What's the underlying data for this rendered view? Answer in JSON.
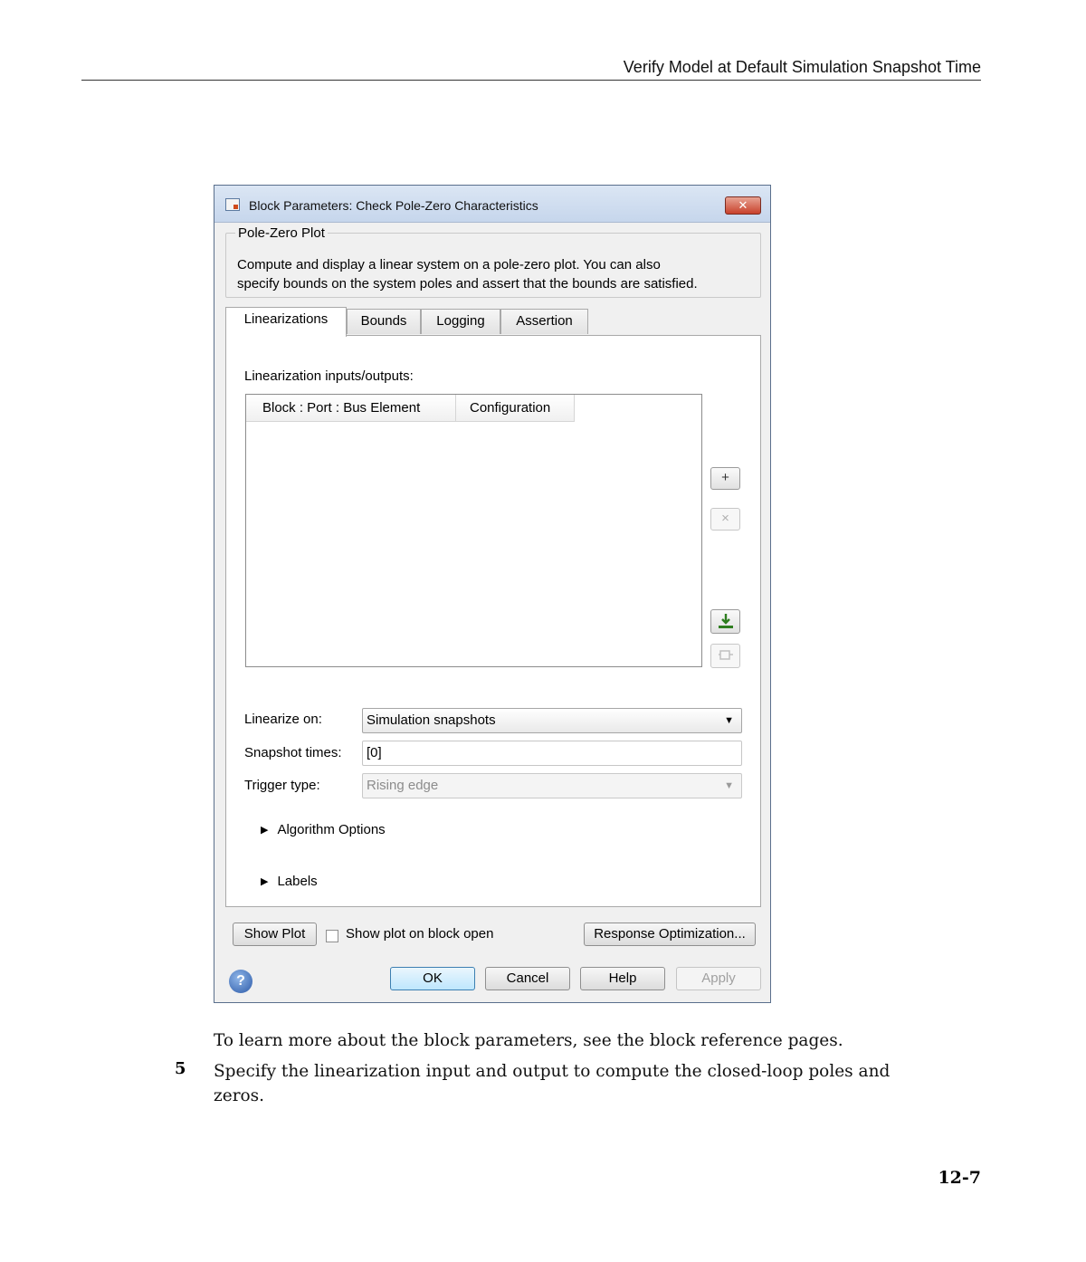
{
  "page": {
    "header_title": "Verify Model at Default Simulation Snapshot Time",
    "page_number": "12-7",
    "body_text_1": "To learn more about the block parameters, see the block reference pages.",
    "step_number": "5",
    "step_text_line1": "Specify the linearization input and output to compute the closed-loop poles and",
    "step_text_line2": "zeros."
  },
  "dialog": {
    "title": "Block Parameters: Check Pole-Zero Characteristics",
    "close_label": "✕",
    "group_title": "Pole-Zero Plot",
    "description_line1": "Compute and display a linear system on a pole-zero plot. You can also",
    "description_line2": "specify bounds on the system poles and assert that the bounds are satisfied.",
    "tabs": [
      {
        "label": "Linearizations",
        "active": true
      },
      {
        "label": "Bounds",
        "active": false
      },
      {
        "label": "Logging",
        "active": false
      },
      {
        "label": "Assertion",
        "active": false
      }
    ],
    "io_label": "Linearization inputs/outputs:",
    "table_columns": [
      "Block : Port : Bus Element",
      "Configuration"
    ],
    "add_label": "+",
    "remove_label": "×",
    "linearize_on_label": "Linearize on:",
    "linearize_on_value": "Simulation snapshots",
    "snapshot_times_label": "Snapshot times:",
    "snapshot_times_value": "[0]",
    "trigger_type_label": "Trigger type:",
    "trigger_type_value": "Rising edge",
    "algorithm_options_label": "Algorithm Options",
    "labels_label": "Labels",
    "show_plot_label": "Show Plot",
    "show_plot_on_open_label": "Show plot on block open",
    "response_opt_label": "Response Optimization...",
    "help_icon_label": "?",
    "ok_label": "OK",
    "cancel_label": "Cancel",
    "help_label": "Help",
    "apply_label": "Apply"
  },
  "icons": [
    "block-params-icon",
    "close-icon",
    "add-icon",
    "remove-icon",
    "select-signal-icon",
    "highlight-icon",
    "dropdown-caret-icon",
    "expand-arrow-icon",
    "help-icon"
  ],
  "colors": {
    "ok_button": "#bee6fd",
    "close_button": "#c8412b",
    "title_bar": "#c6d6ec"
  }
}
